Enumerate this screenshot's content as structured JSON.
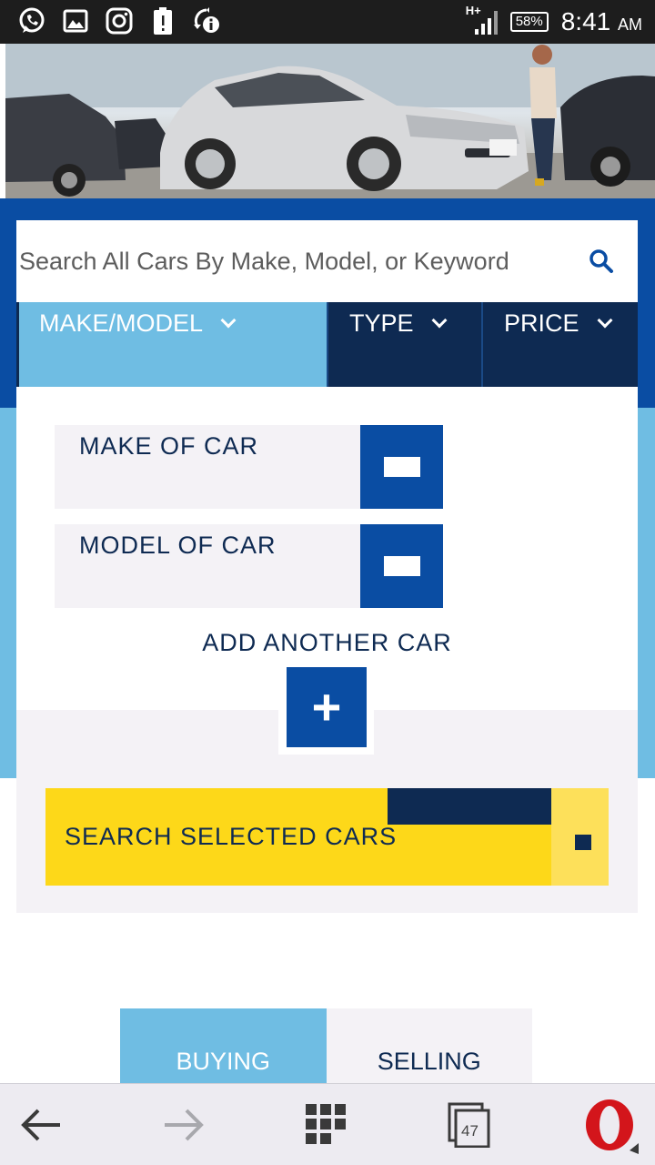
{
  "status_bar": {
    "network": "H+",
    "battery": "58%",
    "time": "8:41",
    "ampm": "AM",
    "icons": [
      "whatsapp-icon",
      "gallery-icon",
      "instagram-icon",
      "battery-alert-icon",
      "sync-info-icon"
    ]
  },
  "search": {
    "placeholder": "Search All Cars By Make, Model, or Keyword"
  },
  "filters": {
    "make_model": "MAKE/MODEL",
    "type": "TYPE",
    "price": "PRICE"
  },
  "form": {
    "make_label": "MAKE OF CAR",
    "model_label": "MODEL OF CAR",
    "add_label": "ADD ANOTHER CAR",
    "add_symbol": "+",
    "search_selected": "SEARCH SELECTED CARS"
  },
  "segments": {
    "buying": "BUYING",
    "selling": "SELLING"
  },
  "browser": {
    "tab_count": "47"
  },
  "colors": {
    "navy": "#0e2a52",
    "blue": "#0a4da3",
    "light_blue": "#6fbde3",
    "yellow": "#fdd819",
    "opera_red": "#d3151b"
  }
}
